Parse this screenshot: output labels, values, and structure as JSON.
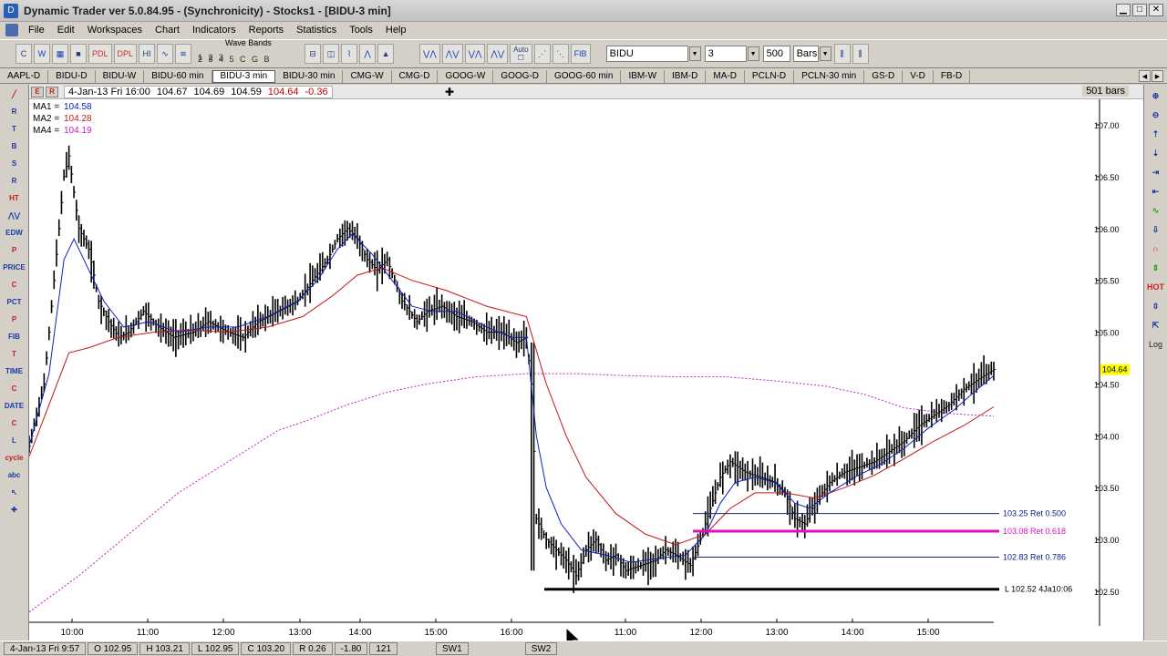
{
  "window": {
    "title": "Dynamic Trader ver 5.0.84.95 - (Synchronicity) - Stocks1 - [BIDU-3 min]"
  },
  "menu": [
    "File",
    "Edit",
    "Workspaces",
    "Chart",
    "Indicators",
    "Reports",
    "Statistics",
    "Tools",
    "Help"
  ],
  "toolbar": {
    "pdl_label": "PDL",
    "dpl_label": "DPL",
    "hi_label": "HI",
    "wave_bands_label": "Wave Bands",
    "wave_bands_top": "1 2 3",
    "wave_bands_bottom": "2 3 4 5 C G B",
    "auto_label": "Auto",
    "fib_label": "FIB",
    "symbol": "BIDU",
    "interval": "3",
    "bar_count": "500",
    "bar_unit": "Bars"
  },
  "tabs": [
    "AAPL-D",
    "BIDU-D",
    "BIDU-W",
    "BIDU-60 min",
    "BIDU-3 min",
    "BIDU-30 min",
    "CMG-W",
    "CMG-D",
    "GOOG-W",
    "GOOG-D",
    "GOOG-60 min",
    "IBM-W",
    "IBM-D",
    "MA-D",
    "PCLN-D",
    "PCLN-30 min",
    "GS-D",
    "V-D",
    "FB-D"
  ],
  "active_tab": "BIDU-3 min",
  "chart_header": {
    "date": "4-Jan-13 Fri 16:00",
    "open": "104.67",
    "high": "104.69",
    "low": "104.59",
    "close": "104.64",
    "change": "-0.36",
    "bars": "501 bars"
  },
  "legend": {
    "ma1_label": "MA1 =",
    "ma1_value": "104.58",
    "ma2_label": "MA2 =",
    "ma2_value": "104.28",
    "ma4_label": "MA4 =",
    "ma4_value": "104.19"
  },
  "left_tools": [
    "R",
    "T",
    "B",
    "S",
    "R",
    "HT",
    "EDW",
    "P",
    "PRICE",
    "C",
    "PCT",
    "P",
    "FIB",
    "T",
    "TIME",
    "C",
    "DATE",
    "C",
    "L",
    "cycle",
    "abc"
  ],
  "right_tools": [
    "Log"
  ],
  "status": {
    "date": "4-Jan-13 Fri 9:57",
    "open": "O 102.95",
    "high": "H 103.21",
    "low": "L 102.95",
    "close": "C 103.20",
    "range": "R 0.26",
    "change": "-1.80",
    "count": "121",
    "sw1": "SW1",
    "sw2": "SW2"
  },
  "colors": {
    "price_bars": "#000000",
    "ma1": "#1020c0",
    "ma2": "#c01818",
    "ma4": "#c020c0",
    "ret_0618": "#e010c0",
    "ret_lines": "#102080",
    "last_price_bg": "#ffff00"
  },
  "chart_data": {
    "type": "bar",
    "symbol": "BIDU",
    "interval": "3 min",
    "ylim": [
      102.2,
      107.2
    ],
    "yticks": [
      "107.00",
      "106.50",
      "106.00",
      "105.50",
      "105.00",
      "104.50",
      "104.00",
      "103.50",
      "103.00",
      "102.50"
    ],
    "ytick_values": [
      107.0,
      106.5,
      106.0,
      105.5,
      105.0,
      104.5,
      104.0,
      103.5,
      103.0,
      102.5
    ],
    "xticks": [
      "10:00",
      "11:00",
      "12:00",
      "13:00",
      "14:00",
      "15:00",
      "16:00",
      "11:00",
      "12:00",
      "13:00",
      "14:00",
      "15:00"
    ],
    "last_price": "104.64",
    "last_price_value": 104.64,
    "price_path": [
      [
        0,
        103.9
      ],
      [
        3,
        104.5
      ],
      [
        5,
        105.5
      ],
      [
        7,
        106.5
      ],
      [
        8,
        106.7
      ],
      [
        10,
        106.0
      ],
      [
        12,
        105.8
      ],
      [
        14,
        105.3
      ],
      [
        16,
        105.1
      ],
      [
        18,
        104.95
      ],
      [
        20,
        105.0
      ],
      [
        23,
        105.2
      ],
      [
        26,
        105.05
      ],
      [
        29,
        104.95
      ],
      [
        33,
        105.0
      ],
      [
        36,
        105.1
      ],
      [
        40,
        105.0
      ],
      [
        43,
        104.95
      ],
      [
        46,
        105.1
      ],
      [
        50,
        105.2
      ],
      [
        54,
        105.3
      ],
      [
        57,
        105.5
      ],
      [
        60,
        105.7
      ],
      [
        62,
        105.9
      ],
      [
        64,
        106.0
      ],
      [
        66,
        105.9
      ],
      [
        68,
        105.7
      ],
      [
        70,
        105.6
      ],
      [
        72,
        105.7
      ],
      [
        75,
        105.3
      ],
      [
        78,
        105.1
      ],
      [
        80,
        105.2
      ],
      [
        83,
        105.25
      ],
      [
        86,
        105.15
      ],
      [
        89,
        105.1
      ],
      [
        92,
        105.0
      ],
      [
        95,
        105.0
      ],
      [
        98,
        104.9
      ],
      [
        100,
        104.95
      ],
      [
        101,
        104.5
      ],
      [
        102,
        103.2
      ],
      [
        104,
        103.0
      ],
      [
        106,
        102.9
      ],
      [
        108,
        102.8
      ],
      [
        110,
        102.65
      ],
      [
        112,
        102.9
      ],
      [
        114,
        103.0
      ],
      [
        116,
        102.8
      ],
      [
        118,
        102.85
      ],
      [
        120,
        102.7
      ],
      [
        123,
        102.75
      ],
      [
        126,
        102.8
      ],
      [
        128,
        102.9
      ],
      [
        130,
        102.85
      ],
      [
        133,
        102.75
      ],
      [
        135,
        103.0
      ],
      [
        137,
        103.3
      ],
      [
        139,
        103.6
      ],
      [
        141,
        103.75
      ],
      [
        144,
        103.65
      ],
      [
        147,
        103.6
      ],
      [
        150,
        103.55
      ],
      [
        152,
        103.45
      ],
      [
        154,
        103.2
      ],
      [
        156,
        103.15
      ],
      [
        158,
        103.35
      ],
      [
        161,
        103.55
      ],
      [
        164,
        103.65
      ],
      [
        167,
        103.7
      ],
      [
        170,
        103.75
      ],
      [
        173,
        103.85
      ],
      [
        176,
        103.95
      ],
      [
        179,
        104.1
      ],
      [
        182,
        104.2
      ],
      [
        185,
        104.3
      ],
      [
        188,
        104.45
      ],
      [
        191,
        104.55
      ],
      [
        194,
        104.64
      ]
    ],
    "ma1_path": [
      [
        0,
        103.9
      ],
      [
        4,
        104.6
      ],
      [
        7,
        105.7
      ],
      [
        9,
        105.9
      ],
      [
        12,
        105.6
      ],
      [
        15,
        105.3
      ],
      [
        19,
        105.05
      ],
      [
        24,
        105.1
      ],
      [
        30,
        105.0
      ],
      [
        36,
        105.05
      ],
      [
        42,
        105.05
      ],
      [
        48,
        105.15
      ],
      [
        54,
        105.3
      ],
      [
        58,
        105.5
      ],
      [
        62,
        105.8
      ],
      [
        65,
        105.95
      ],
      [
        69,
        105.75
      ],
      [
        73,
        105.5
      ],
      [
        77,
        105.25
      ],
      [
        81,
        105.2
      ],
      [
        86,
        105.2
      ],
      [
        92,
        105.05
      ],
      [
        97,
        104.95
      ],
      [
        100,
        104.95
      ],
      [
        102,
        104.0
      ],
      [
        104,
        103.5
      ],
      [
        107,
        103.15
      ],
      [
        111,
        102.9
      ],
      [
        116,
        102.85
      ],
      [
        121,
        102.78
      ],
      [
        127,
        102.82
      ],
      [
        132,
        102.85
      ],
      [
        136,
        103.05
      ],
      [
        139,
        103.35
      ],
      [
        142,
        103.55
      ],
      [
        146,
        103.6
      ],
      [
        150,
        103.55
      ],
      [
        154,
        103.35
      ],
      [
        157,
        103.3
      ],
      [
        161,
        103.45
      ],
      [
        166,
        103.6
      ],
      [
        171,
        103.72
      ],
      [
        176,
        103.88
      ],
      [
        181,
        104.08
      ],
      [
        186,
        104.25
      ],
      [
        190,
        104.42
      ],
      [
        194,
        104.58
      ]
    ],
    "ma2_path": [
      [
        0,
        103.8
      ],
      [
        4,
        104.3
      ],
      [
        8,
        104.8
      ],
      [
        12,
        104.85
      ],
      [
        18,
        104.95
      ],
      [
        25,
        105.0
      ],
      [
        32,
        105.02
      ],
      [
        40,
        105.0
      ],
      [
        48,
        105.05
      ],
      [
        55,
        105.15
      ],
      [
        61,
        105.35
      ],
      [
        66,
        105.55
      ],
      [
        71,
        105.62
      ],
      [
        77,
        105.5
      ],
      [
        84,
        105.4
      ],
      [
        92,
        105.25
      ],
      [
        100,
        105.15
      ],
      [
        104,
        104.5
      ],
      [
        108,
        104.0
      ],
      [
        112,
        103.6
      ],
      [
        118,
        103.25
      ],
      [
        124,
        103.05
      ],
      [
        130,
        102.95
      ],
      [
        136,
        103.05
      ],
      [
        141,
        103.3
      ],
      [
        146,
        103.45
      ],
      [
        152,
        103.45
      ],
      [
        158,
        103.4
      ],
      [
        164,
        103.5
      ],
      [
        170,
        103.62
      ],
      [
        176,
        103.78
      ],
      [
        182,
        103.95
      ],
      [
        188,
        104.1
      ],
      [
        194,
        104.28
      ]
    ],
    "ma4_path": [
      [
        0,
        102.3
      ],
      [
        10,
        102.65
      ],
      [
        20,
        103.05
      ],
      [
        30,
        103.45
      ],
      [
        40,
        103.75
      ],
      [
        50,
        104.05
      ],
      [
        56,
        104.15
      ],
      [
        64,
        104.3
      ],
      [
        72,
        104.42
      ],
      [
        80,
        104.5
      ],
      [
        90,
        104.57
      ],
      [
        100,
        104.6
      ],
      [
        110,
        104.6
      ],
      [
        120,
        104.58
      ],
      [
        130,
        104.57
      ],
      [
        140,
        104.57
      ],
      [
        150,
        104.53
      ],
      [
        160,
        104.48
      ],
      [
        168,
        104.4
      ],
      [
        176,
        104.27
      ],
      [
        184,
        104.22
      ],
      [
        190,
        104.2
      ],
      [
        194,
        104.19
      ]
    ],
    "x_range": [
      0,
      194
    ],
    "session_break_x": 101,
    "retracements": [
      {
        "label": "103.25 Ret 0.500",
        "value": 103.25
      },
      {
        "label": "103.08 Ret 0.618",
        "value": 103.08
      },
      {
        "label": "102.83 Ret 0.786",
        "value": 102.83
      }
    ],
    "low_marker": {
      "label": "L 102.52 4Ja10:06",
      "value": 102.52
    }
  }
}
